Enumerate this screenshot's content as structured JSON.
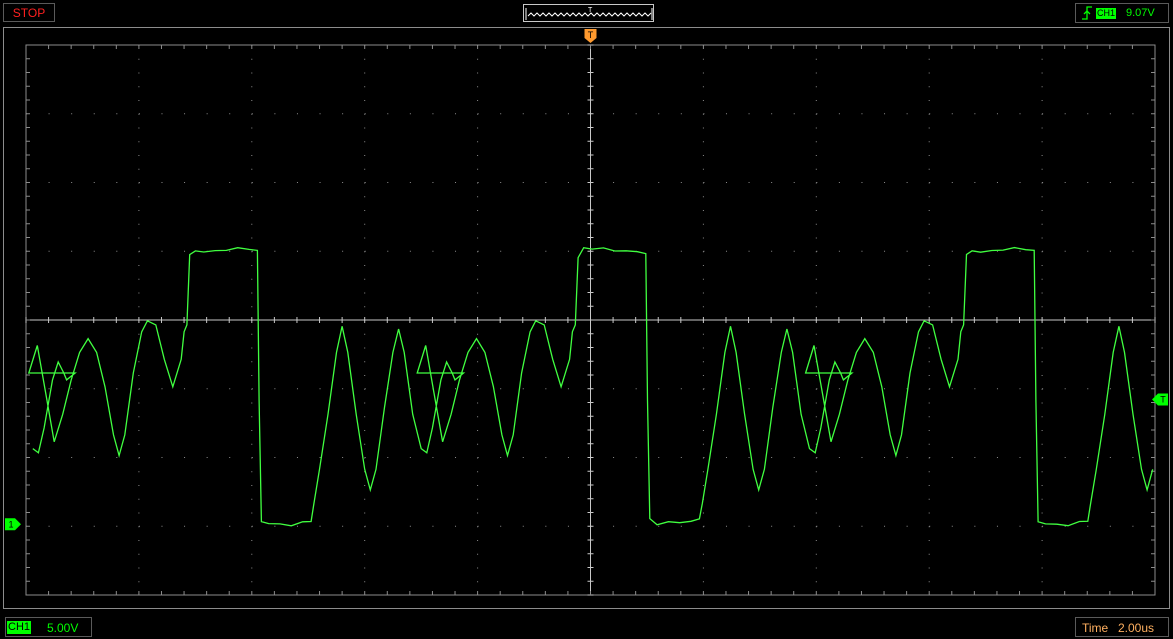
{
  "status": {
    "run_state": "STOP"
  },
  "trigger": {
    "source": "CH1",
    "level": "9.07V",
    "edge_icon": "rising-edge-icon",
    "window_marker": "T",
    "position_marker": "T",
    "level_marker": "T"
  },
  "channel": {
    "label": "CH1",
    "marker": "1",
    "scale": "5.00V",
    "color": "#00ff00"
  },
  "timebase": {
    "label": "Time",
    "value": "2.00us"
  },
  "display": {
    "grid_color": "#8c8c8c",
    "trace_color": "#40ff40",
    "h_divisions": 10,
    "v_divisions": 8,
    "grid": true
  },
  "waveform": {
    "units_v": "V",
    "units_t": "us",
    "samples_per_period": [
      [
        0.0,
        11.0
      ],
      [
        0.15,
        13.0
      ],
      [
        0.3,
        9.5
      ],
      [
        0.45,
        6.0
      ],
      [
        0.6,
        8.0
      ],
      [
        0.75,
        10.5
      ],
      [
        0.9,
        12.5
      ],
      [
        1.05,
        13.5
      ],
      [
        1.2,
        12.5
      ],
      [
        1.35,
        10.0
      ],
      [
        1.5,
        6.5
      ],
      [
        1.6,
        5.0
      ],
      [
        1.7,
        6.5
      ],
      [
        1.85,
        11.0
      ],
      [
        2.0,
        14.0
      ],
      [
        2.1,
        14.8
      ],
      [
        2.25,
        14.5
      ],
      [
        2.4,
        12.0
      ],
      [
        2.55,
        10.0
      ],
      [
        2.7,
        12.0
      ],
      [
        2.75,
        14.0
      ],
      [
        2.8,
        14.5
      ],
      [
        2.85,
        19.5
      ],
      [
        2.95,
        20.0
      ],
      [
        3.1,
        19.9
      ],
      [
        3.3,
        20.0
      ],
      [
        3.5,
        19.9
      ],
      [
        3.7,
        20.0
      ],
      [
        3.9,
        19.9
      ],
      [
        4.05,
        19.8
      ],
      [
        4.08,
        9.0
      ],
      [
        4.12,
        0.3
      ],
      [
        4.25,
        0.0
      ],
      [
        4.45,
        0.1
      ],
      [
        4.65,
        0.0
      ],
      [
        4.85,
        0.2
      ],
      [
        5.0,
        0.3
      ],
      [
        5.05,
        1.5
      ],
      [
        5.15,
        4.0
      ],
      [
        5.3,
        8.0
      ],
      [
        5.45,
        12.5
      ],
      [
        5.55,
        14.4
      ],
      [
        5.65,
        12.5
      ],
      [
        5.8,
        8.0
      ],
      [
        5.95,
        4.0
      ],
      [
        6.05,
        2.5
      ],
      [
        6.15,
        4.0
      ],
      [
        6.3,
        8.5
      ],
      [
        6.45,
        12.5
      ],
      [
        6.55,
        14.2
      ],
      [
        6.65,
        12.5
      ],
      [
        6.8,
        8.0
      ],
      [
        6.95,
        5.5
      ],
      [
        7.05,
        5.2
      ],
      [
        7.15,
        7.0
      ],
      [
        7.3,
        10.5
      ],
      [
        7.4,
        11.8
      ],
      [
        7.5,
        11.0
      ],
      [
        7.55,
        10.5
      ],
      [
        7.7,
        11.0
      ]
    ],
    "period_us": 6.88,
    "start_us": -10.0,
    "end_us": 10.0
  }
}
